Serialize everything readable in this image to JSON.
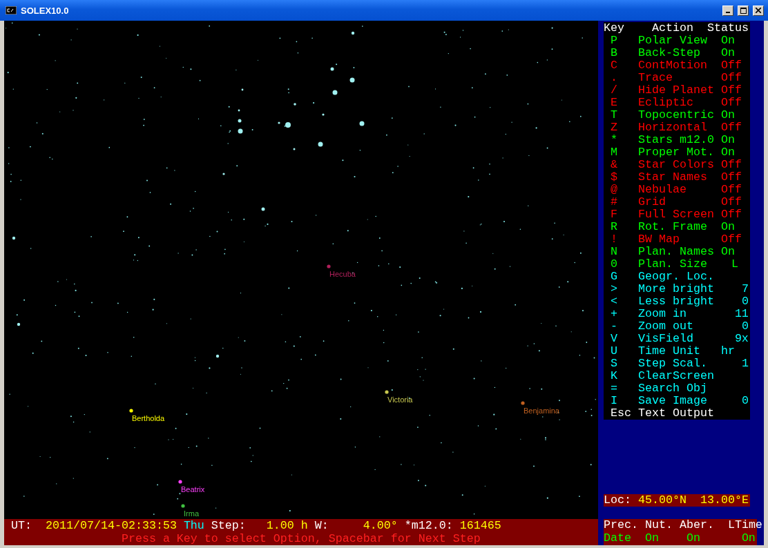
{
  "window": {
    "title": "SOLEX10.0"
  },
  "sky_map": {
    "planets": [
      {
        "name": "Hecuba",
        "color": "#b0205a"
      },
      {
        "name": "Victoria",
        "color": "#c8c850"
      },
      {
        "name": "Bertholda",
        "color": "#ffff00"
      },
      {
        "name": "Benjamina",
        "color": "#c06020"
      },
      {
        "name": "Beatrix",
        "color": "#ff40ff"
      },
      {
        "name": "Irma",
        "color": "#40c040"
      }
    ]
  },
  "menu": {
    "columns": [
      "Key",
      "Action",
      "Status"
    ],
    "items": [
      {
        "key": "P",
        "action": "Polar View",
        "status": "On",
        "color": "#00ff00",
        "kind": "toggle"
      },
      {
        "key": "B",
        "action": "Back-Step",
        "status": "On",
        "color": "#00ff00",
        "kind": "toggle"
      },
      {
        "key": "C",
        "action": "ContMotion",
        "status": "Off",
        "color": "#ff0000",
        "kind": "toggle"
      },
      {
        "key": ".",
        "action": "Trace",
        "status": "Off",
        "color": "#ff0000",
        "kind": "toggle"
      },
      {
        "key": "/",
        "action": "Hide Planet",
        "status": "Off",
        "color": "#ff0000",
        "kind": "toggle"
      },
      {
        "key": "E",
        "action": "Ecliptic",
        "status": "Off",
        "color": "#ff0000",
        "kind": "toggle"
      },
      {
        "key": "T",
        "action": "Topocentric",
        "status": "On",
        "color": "#00ff00",
        "kind": "toggle"
      },
      {
        "key": "Z",
        "action": "Horizontal",
        "status": "Off",
        "color": "#ff0000",
        "kind": "toggle"
      },
      {
        "key": "*",
        "action": "Stars m12.0",
        "status": "On",
        "color": "#00ff00",
        "kind": "toggle"
      },
      {
        "key": "M",
        "action": "Proper Mot.",
        "status": "On",
        "color": "#00ff00",
        "kind": "toggle"
      },
      {
        "key": "&",
        "action": "Star Colors",
        "status": "Off",
        "color": "#ff0000",
        "kind": "toggle"
      },
      {
        "key": "$",
        "action": "Star Names",
        "status": "Off",
        "color": "#ff0000",
        "kind": "toggle"
      },
      {
        "key": "@",
        "action": "Nebulae",
        "status": "Off",
        "color": "#ff0000",
        "kind": "toggle"
      },
      {
        "key": "#",
        "action": "Grid",
        "status": "Off",
        "color": "#ff0000",
        "kind": "toggle"
      },
      {
        "key": "F",
        "action": "Full Screen",
        "status": "Off",
        "color": "#ff0000",
        "kind": "toggle"
      },
      {
        "key": "R",
        "action": "Rot. Frame",
        "status": "On",
        "color": "#00ff00",
        "kind": "toggle"
      },
      {
        "key": "!",
        "action": "BW Map",
        "status": "Off",
        "color": "#ff0000",
        "kind": "toggle"
      },
      {
        "key": "N",
        "action": "Plan. Names",
        "status": "On",
        "color": "#00ff00",
        "kind": "toggle"
      },
      {
        "key": "0",
        "action": "Plan. Size",
        "status": "L",
        "color": "#00ff00",
        "kind": "size"
      },
      {
        "key": "G",
        "action": "Geogr. Loc.",
        "color": "#00ffff",
        "kind": "command"
      },
      {
        "key": ">",
        "action": "More bright",
        "status": "7",
        "color": "#00ffff",
        "kind": "number"
      },
      {
        "key": "<",
        "action": "Less bright",
        "status": "0",
        "color": "#00ffff",
        "kind": "number"
      },
      {
        "key": "+",
        "action": "Zoom in",
        "status": "11",
        "color": "#00ffff",
        "kind": "number"
      },
      {
        "key": "-",
        "action": "Zoom out",
        "status": "0",
        "color": "#00ffff",
        "kind": "number"
      },
      {
        "key": "V",
        "action": "VisField",
        "status": "9x",
        "color": "#00ffff",
        "kind": "number"
      },
      {
        "key": "U",
        "action": "Time Unit",
        "status": "hr",
        "color": "#00ffff",
        "kind": "toggle"
      },
      {
        "key": "S",
        "action": "Step Scal.",
        "status": "1",
        "color": "#00ffff",
        "kind": "number"
      },
      {
        "key": "K",
        "action": "ClearScreen",
        "color": "#00ffff",
        "kind": "command"
      },
      {
        "key": "=",
        "action": "Search Obj",
        "color": "#00ffff",
        "kind": "command"
      },
      {
        "key": "I",
        "action": "Save Image",
        "status": "0",
        "color": "#00ffff",
        "kind": "number"
      },
      {
        "key": "Esc",
        "action": "Text Output",
        "color": "#ffffff",
        "kind": "command"
      }
    ]
  },
  "status_line": {
    "segments": [
      {
        "text": "UT:",
        "kind": "label"
      },
      {
        "text": "2011/07/14-02:33:53",
        "kind": "value"
      },
      {
        "text": "Thu",
        "kind": "day"
      },
      {
        "text": "Step:",
        "kind": "label"
      },
      {
        "text": "1.00 h",
        "kind": "value"
      },
      {
        "text": "W:",
        "kind": "label"
      },
      {
        "text": "4.00°",
        "kind": "value"
      },
      {
        "text": "*m12.0:",
        "kind": "label"
      },
      {
        "text": "161465",
        "kind": "value"
      }
    ],
    "prompt": "Press a Key to select Option, Spacebar for Next Step"
  },
  "location": {
    "label": "Loc:",
    "latitude": "45.00°N",
    "longitude": "13.00°E"
  },
  "corrections": [
    {
      "label": "Prec.",
      "value": "Date"
    },
    {
      "label": "Nut.",
      "value": "On"
    },
    {
      "label": "Aber.",
      "value": "On"
    },
    {
      "label": "LTime",
      "value": "On"
    }
  ]
}
